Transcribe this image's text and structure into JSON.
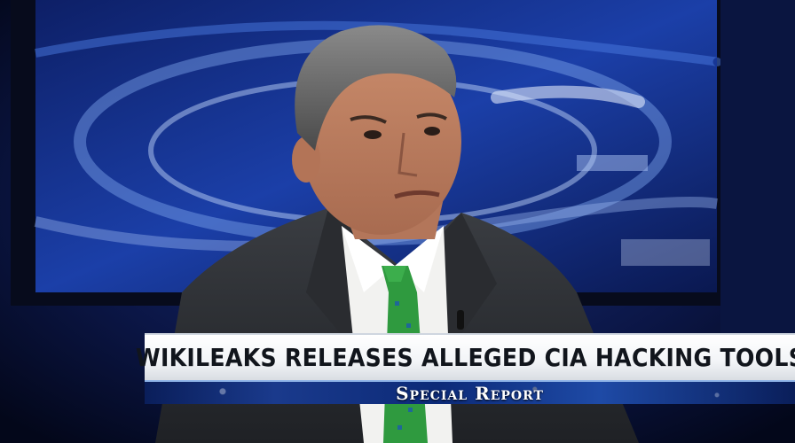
{
  "broadcast": {
    "headline": "WIKILEAKS RELEASES ALLEGED CIA HACKING TOOLS",
    "show_name": "Special Report"
  }
}
